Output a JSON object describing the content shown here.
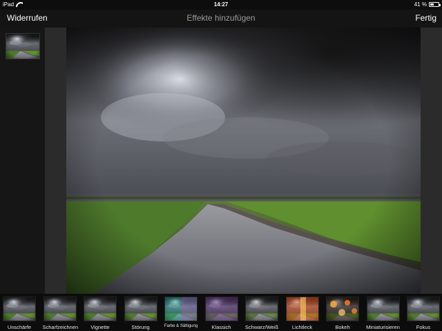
{
  "status_bar": {
    "device": "iPad",
    "time": "14:27",
    "battery": "41 %",
    "battery_level": 0.41
  },
  "nav": {
    "undo_label": "Widerrufen",
    "title": "Effekte hinzufügen",
    "done_label": "Fertig"
  },
  "effects": [
    {
      "label": "Unschärfe",
      "tint": "none"
    },
    {
      "label": "Scharfzeichnen",
      "tint": "none"
    },
    {
      "label": "Vignette",
      "tint": "none"
    },
    {
      "label": "Störung",
      "tint": "none"
    },
    {
      "label": "Farbe & Sättigung",
      "tint": "teal-magenta"
    },
    {
      "label": "Klassich",
      "tint": "purple"
    },
    {
      "label": "Schwarz/Weiß",
      "tint": "grayscale"
    },
    {
      "label": "Lichtleck",
      "tint": "orange-red"
    },
    {
      "label": "Bokeh",
      "tint": "bokeh"
    },
    {
      "label": "Miniaturisieren",
      "tint": "none"
    },
    {
      "label": "Fokus",
      "tint": "none"
    }
  ]
}
